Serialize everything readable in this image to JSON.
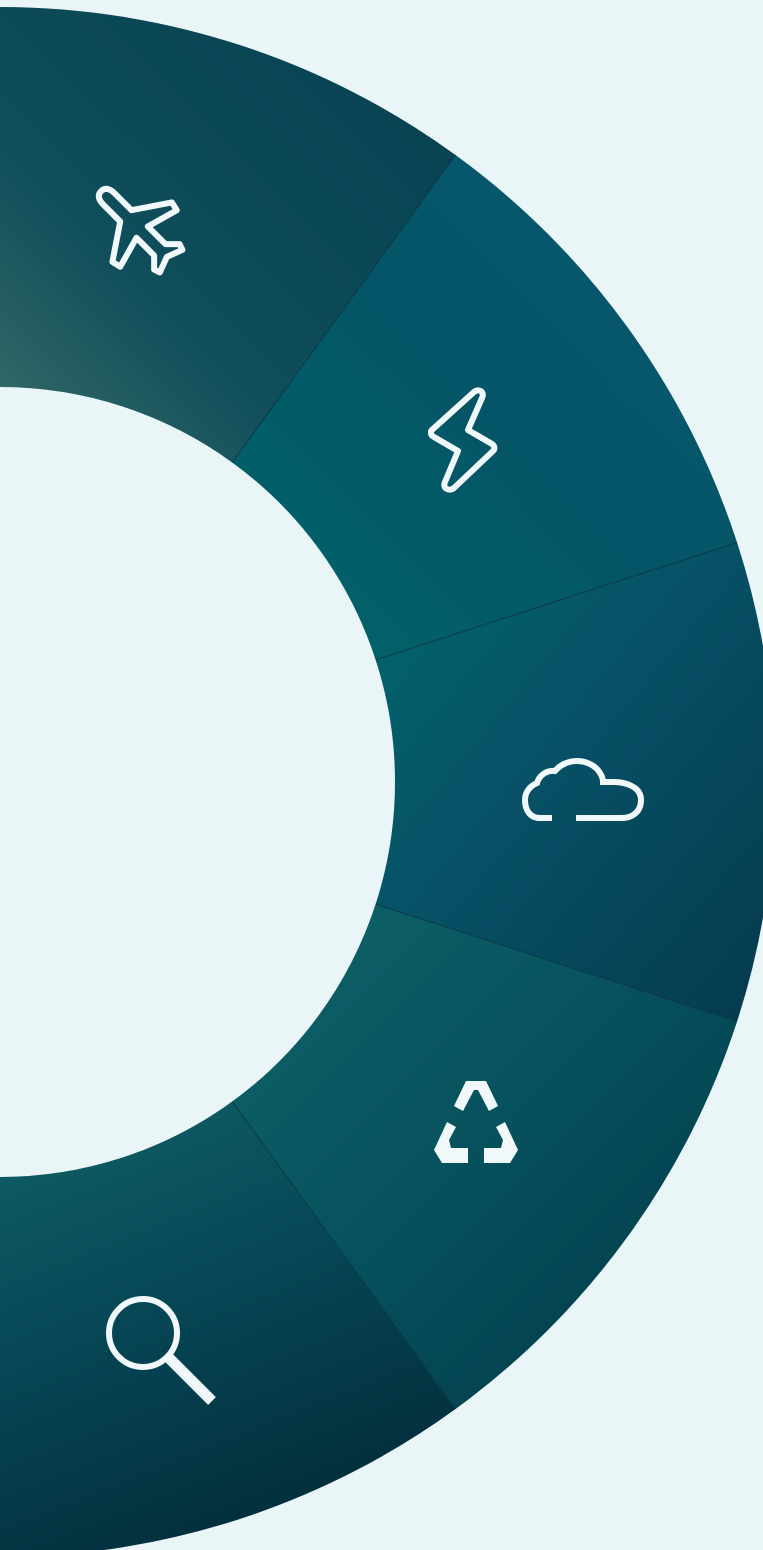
{
  "background": "#e9f5f7",
  "wheel": {
    "segments": [
      {
        "icon": "airplane-icon",
        "color_light": "#2b6a66",
        "color_mid": "#0d4e5c",
        "color_dark": "#053f4f"
      },
      {
        "icon": "lightning-bolt-icon",
        "color_light": "#005f63",
        "color_mid": "#045467",
        "color_dark": "#0a5670"
      },
      {
        "icon": "cloud-icon",
        "color_light": "#01646a",
        "color_mid": "#0a5873",
        "color_dark": "#053d50"
      },
      {
        "icon": "recycle-icon",
        "color_light": "#0e6266",
        "color_mid": "#07505b",
        "color_dark": "#023a48"
      },
      {
        "icon": "search-icon",
        "color_light": "#105e63",
        "color_mid": "#074757",
        "color_dark": "#032f3e"
      }
    ],
    "divider_color": "#0b3a48"
  }
}
